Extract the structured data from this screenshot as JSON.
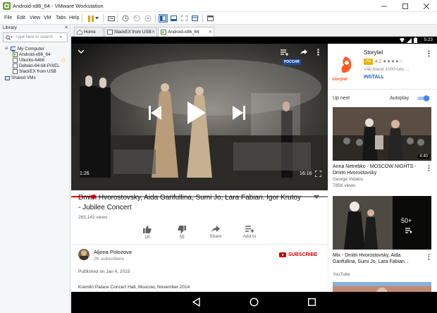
{
  "window": {
    "title": "Android-x86_64 - VMware Workstation"
  },
  "menu": {
    "items": [
      "File",
      "Edit",
      "View",
      "VM",
      "Tabs",
      "Help"
    ]
  },
  "library": {
    "label": "Library",
    "search_placeholder": "Type here to search",
    "tree": [
      "My Computer",
      "Android-x86_64",
      "Ubuntu-64bit",
      "Debian-64-bit-PIXEL",
      "SlackEX from USB",
      "Shared VMs"
    ]
  },
  "tabs": [
    "Home",
    "SlackEX from USB",
    "Android-x86_64"
  ],
  "android": {
    "status_time": "5:23",
    "player": {
      "channel_logo": "РОССИЯ",
      "elapsed": "1:26",
      "duration": "16:16",
      "progress": 0.088
    },
    "video": {
      "title": "Dmitri Hvorostovsky, Aida Garifullina, Sumi Jo, Lara Fabian. Igor Krutoy - Jubilee Concert",
      "views": "265,143 views",
      "actions": [
        {
          "label": "1K",
          "icon": "thumbs-up-icon"
        },
        {
          "label": "59",
          "icon": "thumbs-down-icon"
        },
        {
          "label": "Share",
          "icon": "share-icon"
        },
        {
          "label": "Add to",
          "icon": "add-to-playlist-icon"
        }
      ],
      "channel": "Aljona Polozova",
      "subscribers": "2K subscribers",
      "subscribe_label": "SUBSCRIBE",
      "published": "Published on Jan 4, 2015",
      "description": "Kremlin Palace Concert Hall, Moscow, November 2014"
    },
    "ad": {
      "logo_text": "storytel",
      "title": "Storytel",
      "badge": "Ad",
      "rating": "4.2",
      "stars": "★★★★☆",
      "description": "Välj bland 1000-tals ...",
      "install": "INSTALL"
    },
    "up_next": "Up next",
    "autoplay": "Autoplay",
    "autoplay_on": true,
    "related": [
      {
        "title": "Anna Netrebko - MOSCOW NIGHTS - Dmitri Hvorostovsky",
        "channel": "George Vidakis",
        "views": "785K views",
        "duration": "4:40"
      },
      {
        "title": "Mix - Dmitri Hvorostovsky, Aida Garifullina, Sumi Jo, Lara Fabian...",
        "channel": "YouTube",
        "badge": "50+"
      }
    ],
    "colors": {
      "accent_red": "#ff0000",
      "subscribe": "#cc0000",
      "install": "#1565c0",
      "toggle": "#4285f4"
    }
  }
}
